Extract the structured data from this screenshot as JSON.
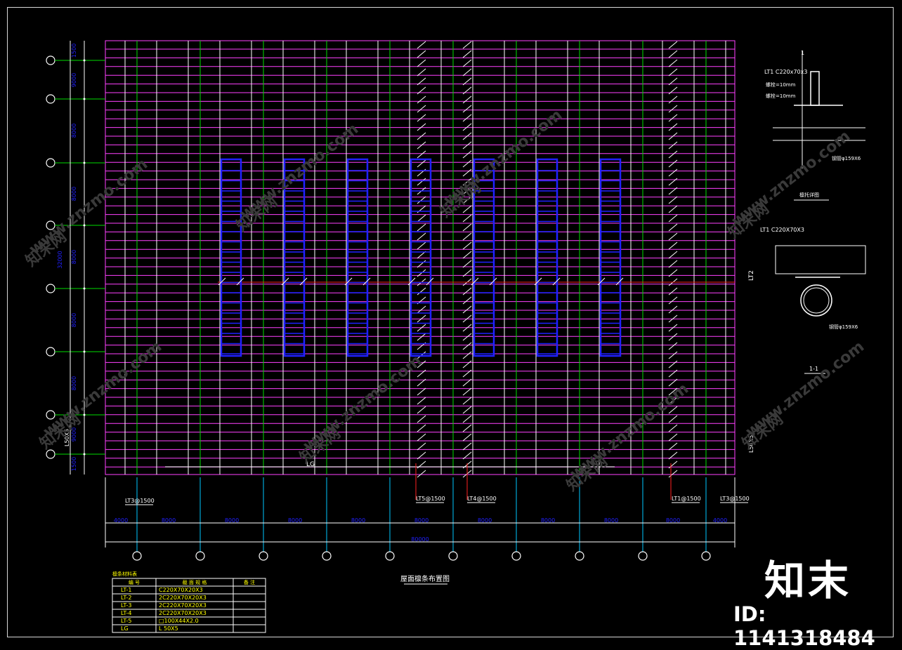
{
  "colors": {
    "purlin": "#ff40ff",
    "rafter": "#ffffff",
    "green_line": "#00dd00",
    "brace": "#2020ff",
    "dim_cyan": "#00c8ff",
    "red": "#ff2020",
    "text_yellow": "#ffff00"
  },
  "plan": {
    "title": "屋面檩条布置图",
    "lg_label": "LG",
    "lt2_label": "LT2",
    "l50_label_left": "L50X5",
    "l50_label_right": "L50X5",
    "bottom_labels": [
      {
        "text": "LT3@1500"
      },
      {
        "text": "LT5@1500"
      },
      {
        "text": "LT4@1500"
      },
      {
        "text": "LT1@1500"
      },
      {
        "text": "LT3@1500"
      }
    ],
    "bottom_dims": [
      "4000",
      "8000",
      "8000",
      "8000",
      "8000",
      "8000",
      "8000",
      "8000",
      "8000",
      "8000",
      "4000"
    ],
    "bottom_total": "80000",
    "left_dims": [
      "1500",
      "9000",
      "8000",
      "8000",
      "8000",
      "8000",
      "8000",
      "9000",
      "1500"
    ],
    "left_total": "32000"
  },
  "schedule": {
    "title": "檩条材料表",
    "headers": [
      "编 号",
      "截 面 规 格",
      "备 注"
    ],
    "rows": [
      [
        "LT-1",
        "C220X70X20X3",
        ""
      ],
      [
        "LT-2",
        "2C220X70X20X3",
        ""
      ],
      [
        "LT-3",
        "2C220X70X20X3",
        ""
      ],
      [
        "LT-4",
        "2C220X70X20X3",
        ""
      ],
      [
        "LT-5",
        "□100X44X2.0",
        ""
      ],
      [
        "LG",
        "L 50X5",
        ""
      ]
    ]
  },
  "detail1": {
    "label_top": "LT1 C220x70x3",
    "note_a": "螺栓=10mm",
    "note_b": "螺栓=10mm",
    "pipe_label": "钢管φ159X6",
    "section_mark": "1",
    "caption": "檩托详图"
  },
  "detail2": {
    "label_top": "LT1 C220X70X3",
    "pipe_label": "钢管φ159X6",
    "caption": "1-1"
  },
  "watermark": {
    "brand": "知末",
    "id_text": "ID: 1141318484",
    "diagonal_texts": [
      "www.znzmo.com",
      "知末网"
    ]
  }
}
